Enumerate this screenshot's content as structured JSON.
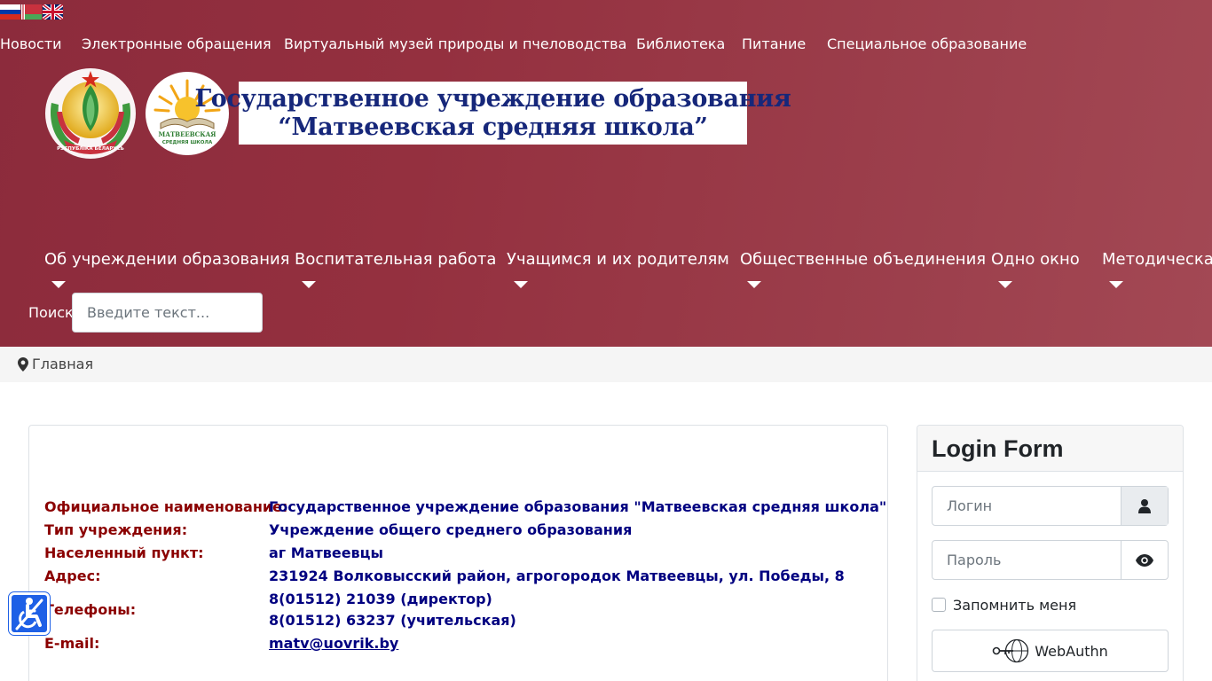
{
  "language_flags": [
    {
      "name": "Русский",
      "colors": [
        "#ffffff",
        "#0039a6",
        "#d52b1e"
      ]
    },
    {
      "name": "Беларуская",
      "colors": [
        "#c8313e",
        "#4aa657"
      ]
    },
    {
      "name": "English",
      "colors": [
        "#012169",
        "#ffffff",
        "#c8102e"
      ]
    }
  ],
  "top_nav": [
    "Новости",
    "Электронные обращения",
    "Виртуальный музей природы и пчеловодства",
    "Библиотека",
    "Питание",
    "Специальное образование"
  ],
  "emblem": {
    "ribbon_text": "РЭСПУБЛІКА БЕЛАРУСЬ"
  },
  "school_logo": {
    "text_line1": "МАТВЕЕВСКАЯ",
    "text_line2": "СРЕДНЯЯ ШКОЛА"
  },
  "banner": {
    "line1": "Государственное учреждение образования",
    "line2": "“Матвеевская средняя школа”"
  },
  "main_menu": [
    "Об учреждении образования",
    "Воспитательная работа",
    "Учащимся и их родителям",
    "Общественные объединения",
    "Одно окно",
    "Методическая"
  ],
  "search": {
    "label": "Поиск",
    "placeholder": "Введите текст..."
  },
  "breadcrumb": {
    "icon": "map-marker-icon",
    "label": "Главная"
  },
  "info": [
    {
      "key": "Официальное наименование:",
      "value": "Государственное учреждение образования \"Матвеевская средняя школа\""
    },
    {
      "key": "Тип учреждения:",
      "value": "Учреждение общего среднего образования"
    },
    {
      "key": "Населенный пункт:",
      "value": "аг Матвеевцы"
    },
    {
      "key": "Адрес:",
      "value": "231924 Волковысский район, агрогородок Матвеевцы, ул. Победы, 8"
    },
    {
      "key": "Телефоны:",
      "value": "8(01512) 21039 (директор)",
      "value2": "8(01512) 63237 (учительская)"
    },
    {
      "key": "E-mail:",
      "value": "matv@uovrik.by"
    }
  ],
  "login": {
    "title": "Login Form",
    "username_placeholder": "Логин",
    "password_placeholder": "Пароль",
    "remember_label": "Запомнить меня",
    "webauthn_label": "WebAuthn"
  },
  "accessibility": {
    "icon": "wheelchair-icon"
  },
  "colors": {
    "header": "#94303f",
    "label_red": "#8b0000",
    "value_blue": "#000080",
    "access_blue": "#1e60e6"
  }
}
